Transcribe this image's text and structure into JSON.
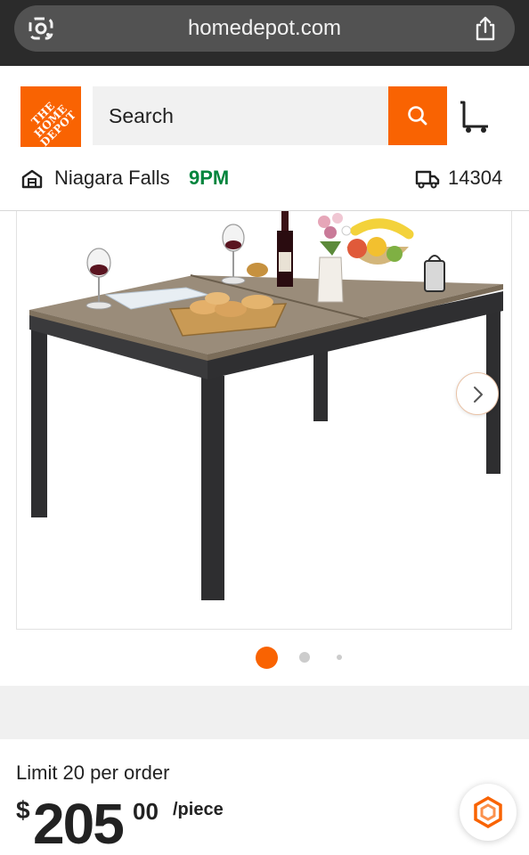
{
  "browser": {
    "url": "homedepot.com"
  },
  "header": {
    "logo_text": "THE HOME DEPOT",
    "search_placeholder": "Search"
  },
  "location": {
    "store_name": "Niagara Falls",
    "store_time": "9PM",
    "zip": "14304"
  },
  "gallery": {
    "image_alt": "Rectangular patio dining table",
    "dots": 3,
    "active_dot": 1
  },
  "price": {
    "limit_text": "Limit 20 per order",
    "currency": "$",
    "dollars": "205",
    "cents": "00",
    "unit": "/piece"
  },
  "colors": {
    "brand_orange": "#f96302",
    "green_time": "#00853d"
  }
}
